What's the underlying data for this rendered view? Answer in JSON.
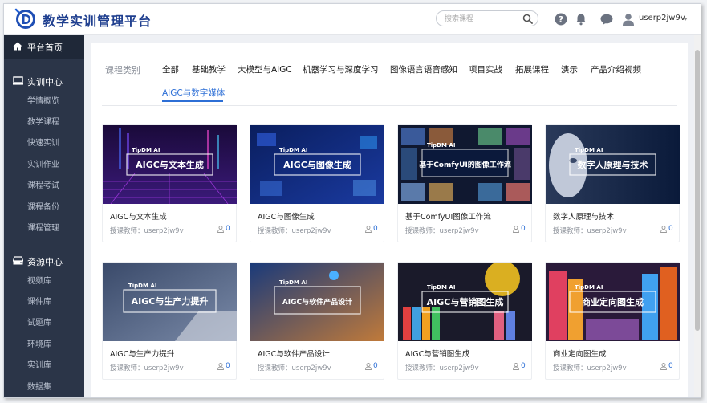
{
  "header": {
    "title": "教学实训管理平台",
    "search_placeholder": "搜索课程",
    "username": "userp2jw9v",
    "icons": [
      "logo-icon",
      "search-icon",
      "help-icon",
      "bell-icon",
      "chat-icon",
      "avatar-icon",
      "chevron-down-icon"
    ]
  },
  "sidebar": {
    "home": "平台首页",
    "sections": [
      {
        "label": "实训中心",
        "icon": "monitor-icon",
        "items": [
          "学情概览",
          "教学课程",
          "快速实训",
          "实训作业",
          "课程考试",
          "课程备份",
          "课程管理"
        ]
      },
      {
        "label": "资源中心",
        "icon": "drive-icon",
        "items": [
          "视频库",
          "课件库",
          "试题库",
          "环境库",
          "实训库",
          "数据集"
        ]
      }
    ]
  },
  "categories": {
    "label": "课程类别",
    "tabs": [
      "全部",
      "基础教学",
      "大模型与AIGC",
      "机器学习与深度学习",
      "图像语言语音感知",
      "项目实战",
      "拓展课程",
      "演示",
      "产品介绍视频"
    ],
    "active": "AIGC与数字媒体"
  },
  "courses": [
    {
      "title": "AIGC与文本生成",
      "teacher": "授课教师：userp2jw9v",
      "count": "0",
      "brand": "TipDM AI",
      "banner": "AIGC与文本生成"
    },
    {
      "title": "AIGC与图像生成",
      "teacher": "授课教师：userp2jw9v",
      "count": "0",
      "brand": "TipDM AI",
      "banner": "AIGC与图像生成"
    },
    {
      "title": "基于ComfyUI图像工作流",
      "teacher": "授课教师：userp2jw9v",
      "count": "0",
      "brand": "TipDM AI",
      "banner": "基于ComfyUI的图像工作流"
    },
    {
      "title": "数字人原理与技术",
      "teacher": "授课教师：userp2jw9v",
      "count": "0",
      "brand": "TipDM AI",
      "banner": "数字人原理与技术"
    },
    {
      "title": "AIGC与生产力提升",
      "teacher": "授课教师：userp2jw9v",
      "count": "0",
      "brand": "TipDM AI",
      "banner": "AIGC与生产力提升"
    },
    {
      "title": "AIGC与软件产品设计",
      "teacher": "授课教师：userp2jw9v",
      "count": "0",
      "brand": "TipDM AI",
      "banner": "AIGC与软件产品设计"
    },
    {
      "title": "AIGC与营销图生成",
      "teacher": "授课教师：userp2jw9v",
      "count": "0",
      "brand": "TipDM AI",
      "banner": "AIGC与营销图生成"
    },
    {
      "title": "商业定向图生成",
      "teacher": "授课教师：userp2jw9v",
      "count": "0",
      "brand": "TipDM AI",
      "banner": "商业定向图生成"
    }
  ],
  "colors": {
    "brand": "#1f3f8f",
    "accent": "#2d6fd6",
    "sidebar": "#2b3548"
  }
}
